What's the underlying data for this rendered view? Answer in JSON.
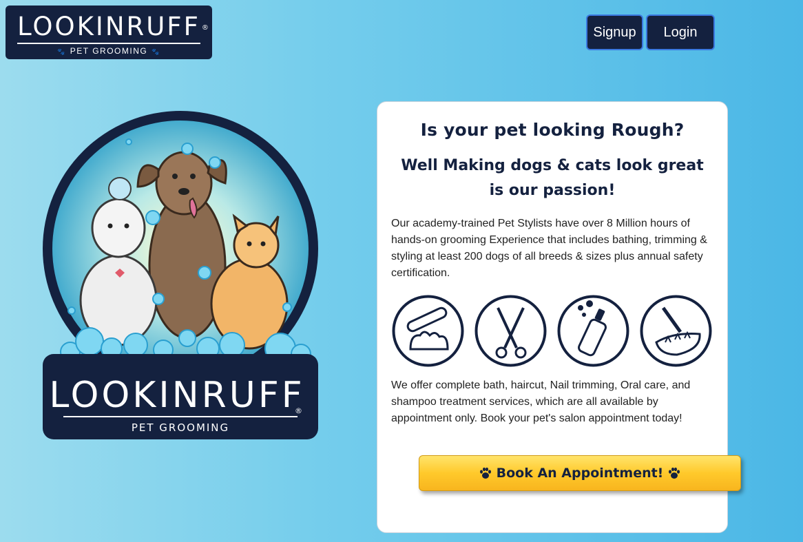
{
  "header": {
    "logo": {
      "brand": "LOOKINRUFF",
      "registered": "®",
      "tagline": "PET GROOMING",
      "paws": "❖ ❖ ❖"
    },
    "signup_label": "Signup",
    "login_label": "Login"
  },
  "hero": {
    "brand": "LOOKINRUFF",
    "registered": "®",
    "tagline": "PET GROOMING"
  },
  "card": {
    "heading": "Is your pet looking Rough?",
    "subheading": "Well Making dogs & cats look great is our passion!",
    "intro": "Our academy-trained Pet Stylists have over 8 Million hours of hands-on grooming Experience that includes bathing, trimming & styling at least 200 dogs of all breeds & sizes plus annual safety certification.",
    "services": [
      {
        "icon": "nail-file-paw-icon"
      },
      {
        "icon": "scissors-icon"
      },
      {
        "icon": "shampoo-bottle-icon"
      },
      {
        "icon": "toothbrush-teeth-icon"
      }
    ],
    "offer": "We offer complete bath, haircut, Nail trimming, Oral care, and shampoo treatment services, which are all available by appointment only. Book your pet's salon appointment today!"
  },
  "cta": {
    "label": "Book An Appointment!"
  },
  "colors": {
    "navy": "#14213f",
    "sky": "#4bb7e6",
    "gold": "#ffc92b"
  }
}
